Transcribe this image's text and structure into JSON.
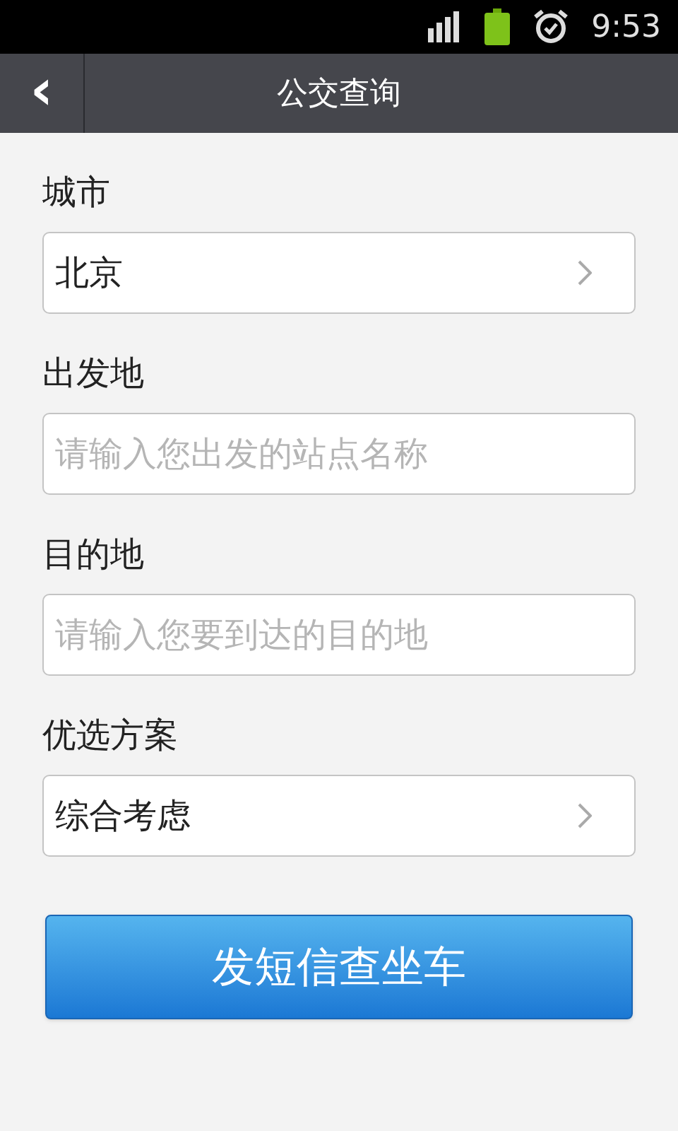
{
  "status_bar": {
    "time": "9:53"
  },
  "header": {
    "back": "‹",
    "title": "公交查询"
  },
  "fields": [
    {
      "label": "城市",
      "kind": "select",
      "value": "北京"
    },
    {
      "label": "出发地",
      "kind": "input",
      "placeholder": "请输入您出发的站点名称"
    },
    {
      "label": "目的地",
      "kind": "input",
      "placeholder": "请输入您要到达的目的地"
    },
    {
      "label": "优选方案",
      "kind": "select",
      "value": "综合考虑"
    }
  ],
  "button": "发短信查坐车"
}
